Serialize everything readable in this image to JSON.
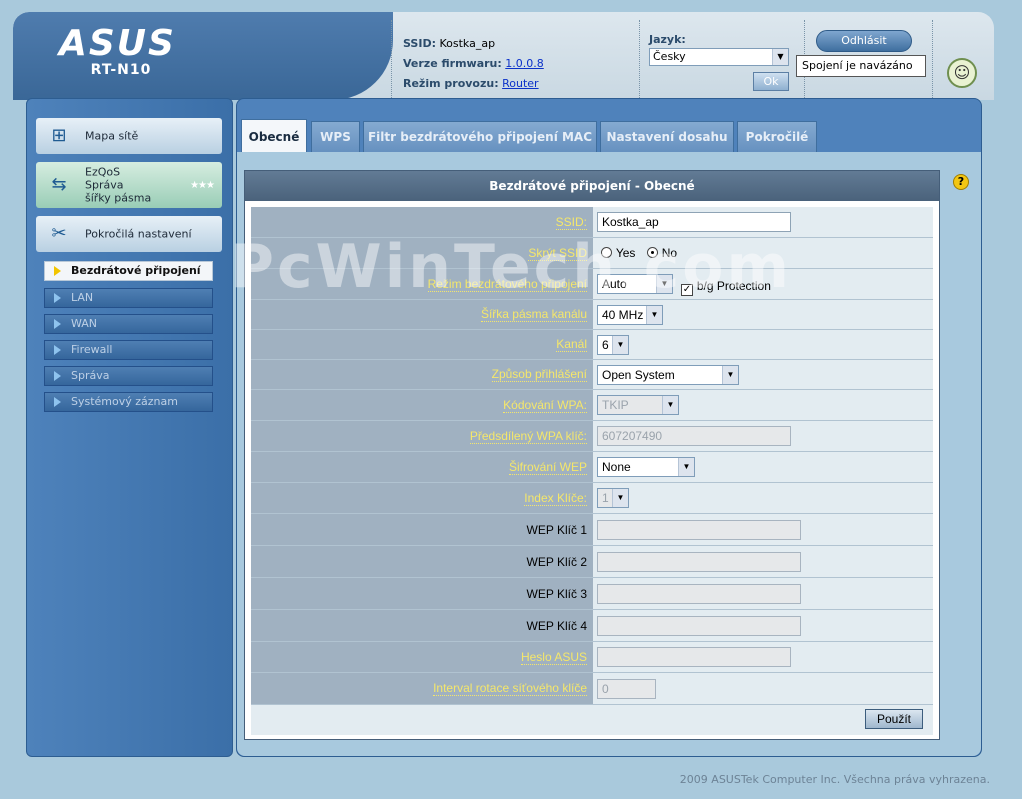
{
  "header": {
    "brand": "ASUS",
    "model": "RT-N10",
    "ssid_label": "SSID:",
    "ssid_value": "Kostka_ap",
    "firmware_label": "Verze firmwaru:",
    "firmware_value": "1.0.0.8",
    "mode_label": "Režim provozu:",
    "mode_value": "Router",
    "language_label": "Jazyk:",
    "language_value": "Česky",
    "ok_label": "Ok",
    "logout_label": "Odhlásit",
    "status_tooltip": "Spojení je navázáno"
  },
  "sidebar": {
    "main": [
      {
        "label": "Mapa sítě",
        "icon": "network-map-icon"
      },
      {
        "label": "EzQoS Správa šířky pásma",
        "icon": "bandwidth-icon"
      },
      {
        "label": "Pokročilá nastavení",
        "icon": "tools-icon"
      }
    ],
    "ezqos_lines": [
      "EzQoS",
      "Správa",
      "šířky pásma"
    ],
    "sub": [
      {
        "label": "Bezdrátové připojení",
        "active": true
      },
      {
        "label": "LAN"
      },
      {
        "label": "WAN"
      },
      {
        "label": "Firewall"
      },
      {
        "label": "Správa"
      },
      {
        "label": "Systémový záznam"
      }
    ]
  },
  "tabs": [
    "Obecné",
    "WPS",
    "Filtr bezdrátového připojení MAC",
    "Nastavení dosahu",
    "Pokročilé"
  ],
  "panel": {
    "title": "Bezdrátové připojení - Obecné",
    "fields": {
      "ssid": {
        "label": "SSID:",
        "value": "Kostka_ap"
      },
      "hide_ssid": {
        "label": "Skrýt SSID",
        "yes": "Yes",
        "no": "No",
        "selected": "No"
      },
      "mode": {
        "label": "Režim bezdrátového připojení",
        "value": "Auto",
        "protection_label": "b/g Protection",
        "protection_checked": true
      },
      "bandwidth": {
        "label": "Šířka pásma kanálu",
        "value": "40 MHz"
      },
      "channel": {
        "label": "Kanál",
        "value": "6"
      },
      "auth": {
        "label": "Způsob přihlášení",
        "value": "Open System"
      },
      "wpa_enc": {
        "label": "Kódování WPA:",
        "value": "TKIP"
      },
      "psk": {
        "label": "Předsdílený WPA klíč:",
        "value": "607207490"
      },
      "wep_enc": {
        "label": "Šifrování WEP",
        "value": "None"
      },
      "key_index": {
        "label": "Index Klíče:",
        "value": "1"
      },
      "wep1": {
        "label": "WEP Klíč 1",
        "value": ""
      },
      "wep2": {
        "label": "WEP Klíč 2",
        "value": ""
      },
      "wep3": {
        "label": "WEP Klíč 3",
        "value": ""
      },
      "wep4": {
        "label": "WEP Klíč 4",
        "value": ""
      },
      "asus_pass": {
        "label": "Heslo ASUS",
        "value": ""
      },
      "rekey": {
        "label": "Interval rotace síťového klíče",
        "value": "0"
      }
    },
    "apply_label": "Použít"
  },
  "watermark": "PcWinTech.com",
  "footer": "2009 ASUSTek Computer Inc. Všechna práva vyhrazena."
}
